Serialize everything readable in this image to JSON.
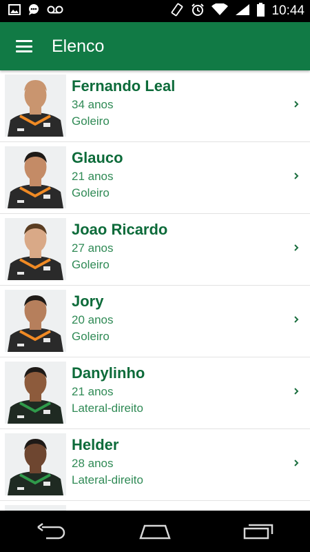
{
  "status_bar": {
    "time": "10:44",
    "icons": [
      "image-icon",
      "chat-icon",
      "voicemail-icon",
      "rotate-icon",
      "alarm-icon",
      "wifi-icon",
      "signal-icon",
      "battery-icon"
    ]
  },
  "app_bar": {
    "title": "Elenco",
    "menu_icon": "menu-icon",
    "color": "#117a45"
  },
  "players": [
    {
      "name": "Fernando Leal",
      "age": "34 anos",
      "position": "Goleiro",
      "skin": "#c9956f",
      "hair": "#c9956f",
      "jersey": "#2a2a2a",
      "accent": "#f08a24"
    },
    {
      "name": "Glauco",
      "age": "21 anos",
      "position": "Goleiro",
      "skin": "#c48b66",
      "hair": "#1e1a17",
      "jersey": "#2a2a2a",
      "accent": "#f08a24"
    },
    {
      "name": "Joao Ricardo",
      "age": "27 anos",
      "position": "Goleiro",
      "skin": "#d9a987",
      "hair": "#5a3d22",
      "jersey": "#2a2a2a",
      "accent": "#f08a24"
    },
    {
      "name": "Jory",
      "age": "20 anos",
      "position": "Goleiro",
      "skin": "#b67f5c",
      "hair": "#1e1a17",
      "jersey": "#2a2a2a",
      "accent": "#f08a24"
    },
    {
      "name": "Danylinho",
      "age": "21 anos",
      "position": "Lateral-direito",
      "skin": "#8d5b3c",
      "hair": "#1e1a17",
      "jersey": "#1f2a22",
      "accent": "#2f9a4a"
    },
    {
      "name": "Helder",
      "age": "28 anos",
      "position": "Lateral-direito",
      "skin": "#6e4630",
      "hair": "#1e1a17",
      "jersey": "#1f2a22",
      "accent": "#2f9a4a"
    },
    {
      "name": "",
      "age": "",
      "position": "",
      "skin": "#9a6a48",
      "hair": "#1e1a17",
      "jersey": "#1f2a22",
      "accent": "#2f9a4a"
    }
  ],
  "nav_bar": {
    "icons": [
      "back-icon",
      "home-icon",
      "recents-icon"
    ]
  }
}
